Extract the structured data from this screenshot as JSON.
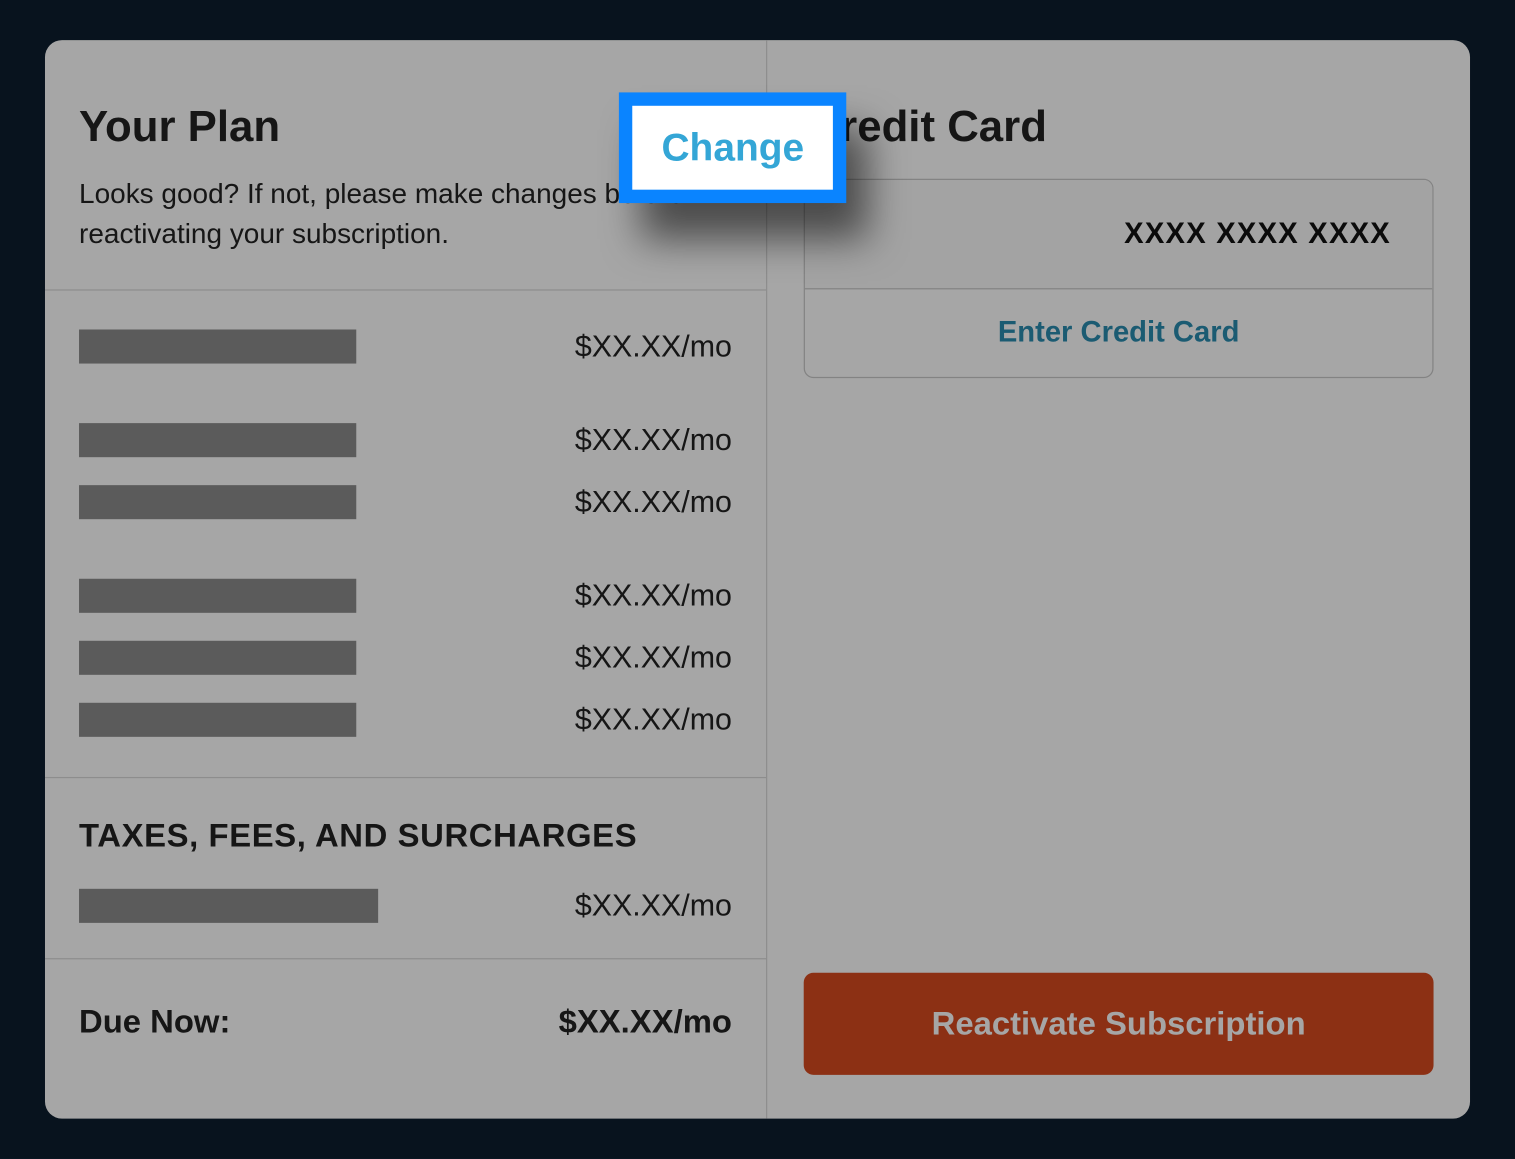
{
  "plan": {
    "title": "Your Plan",
    "subtitle": "Looks good? If not, please make changes before reactivating your subscription.",
    "change_label": "Change",
    "items": [
      {
        "price": "$XX.XX/mo"
      },
      {
        "price": "$XX.XX/mo"
      },
      {
        "price": "$XX.XX/mo"
      },
      {
        "price": "$XX.XX/mo"
      },
      {
        "price": "$XX.XX/mo"
      },
      {
        "price": "$XX.XX/mo"
      }
    ]
  },
  "taxes": {
    "title": "TAXES, FEES, AND SURCHARGES",
    "price": "$XX.XX/mo"
  },
  "due": {
    "label": "Due Now:",
    "price": "$XX.XX/mo"
  },
  "credit_card": {
    "title": "Credit Card",
    "masked": "XXXX XXXX XXXX",
    "enter_label": "Enter Credit Card"
  },
  "reactivate_label": "Reactivate Subscription"
}
